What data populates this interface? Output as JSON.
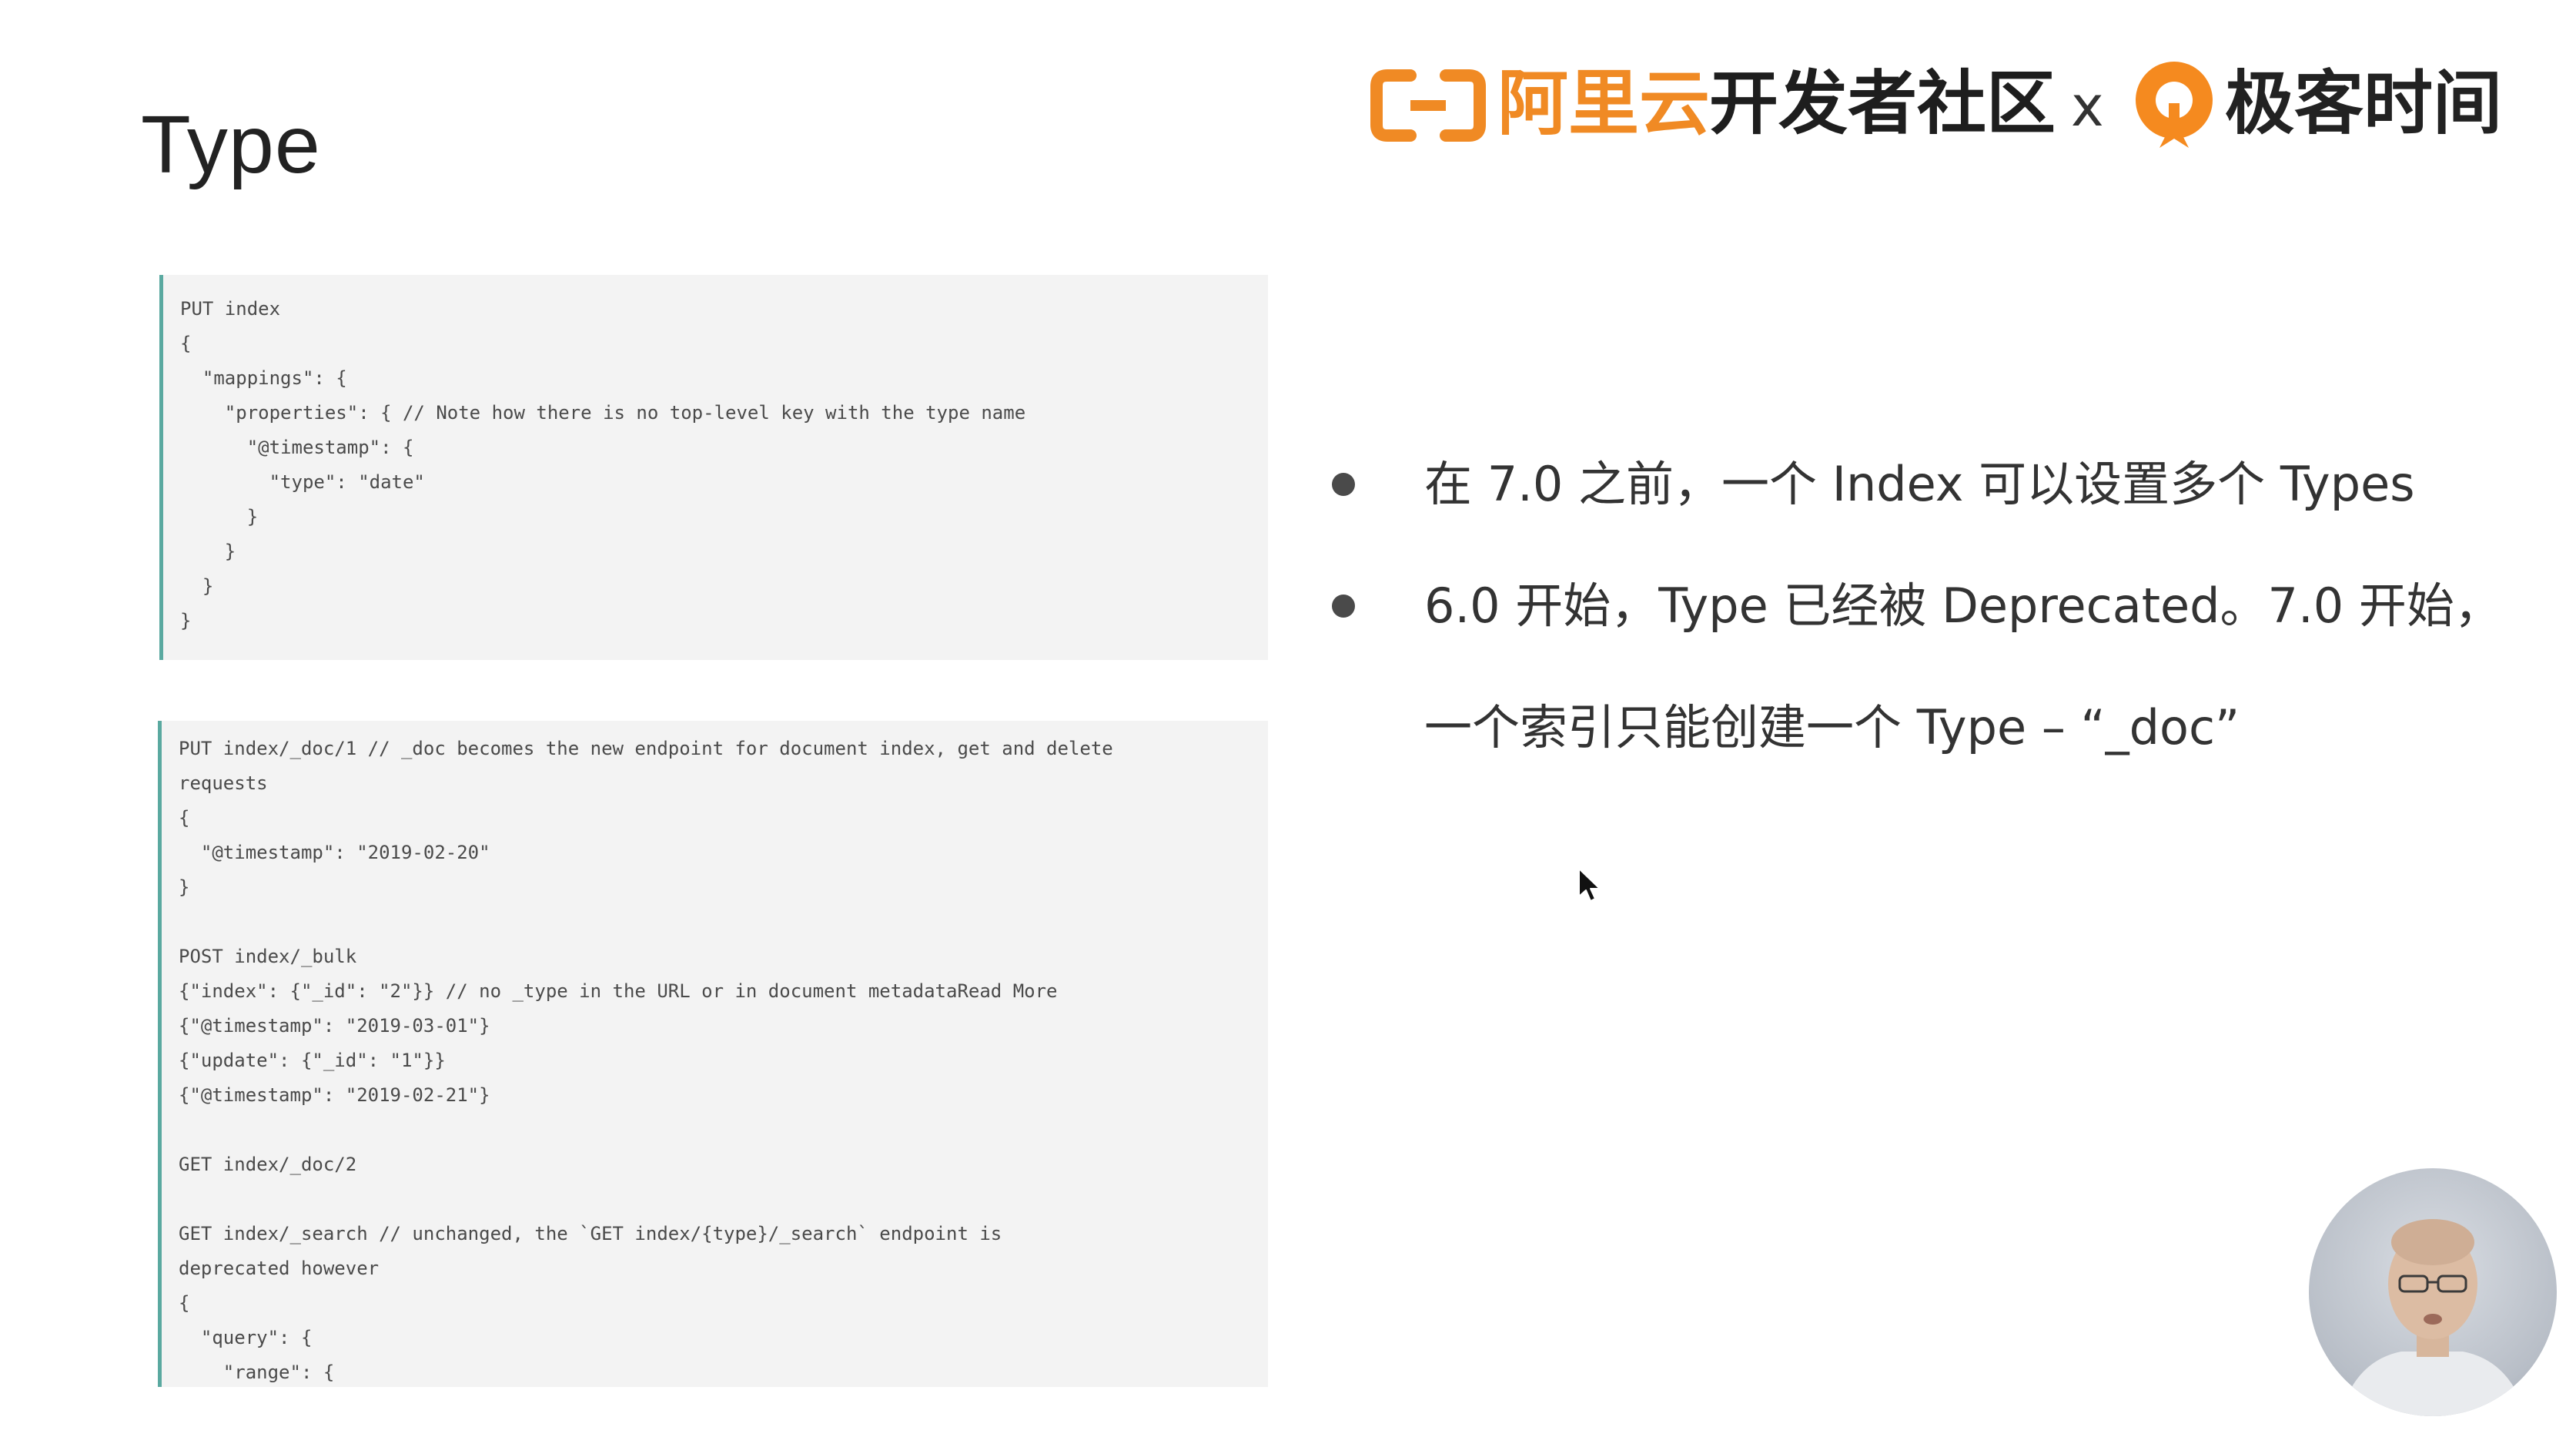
{
  "slide": {
    "title": "Type"
  },
  "brand": {
    "aliyun_logo_icon": "aliyun-bracket-icon",
    "aliyun_name": "阿里云",
    "community": "开发者社区",
    "separator": "x",
    "geek_logo_icon": "geektime-icon",
    "geek_name": "极客时间",
    "colors": {
      "aliyun_orange": "#f08a24",
      "geek_orange": "#f58a1f",
      "text_dark": "#1e1e1e"
    }
  },
  "code_top": {
    "lines": [
      "PUT index",
      "{",
      "  \"mappings\": {",
      "    \"properties\": { // Note how there is no top-level key with the type name",
      "      \"@timestamp\": {",
      "        \"type\": \"date\"",
      "      }",
      "    }",
      "  }",
      "}"
    ]
  },
  "code_bottom": {
    "lines": [
      "PUT index/_doc/1 // _doc becomes the new endpoint for document index, get and delete",
      "requests",
      "{",
      "  \"@timestamp\": \"2019-02-20\"",
      "}",
      "",
      "POST index/_bulk",
      "{\"index\": {\"_id\": \"2\"}} // no _type in the URL or in document metadataRead More",
      "{\"@timestamp\": \"2019-03-01\"}",
      "{\"update\": {\"_id\": \"1\"}}",
      "{\"@timestamp\": \"2019-02-21\"}",
      "",
      "GET index/_doc/2",
      "",
      "GET index/_search // unchanged, the `GET index/{type}/_search` endpoint is",
      "deprecated however",
      "{",
      "  \"query\": {",
      "    \"range\": {"
    ]
  },
  "bullets": [
    {
      "text": "在 7.0 之前，一个 Index 可以设置多个 Types"
    },
    {
      "text": "6.0 开始，Type 已经被 Deprecated。7.0 开始，",
      "continuation": "一个索引只能创建一个 Type – “_doc”"
    }
  ],
  "overlay": {
    "cursor_icon": "mouse-pointer-icon",
    "webcam": "presenter-webcam"
  },
  "colors": {
    "code_background": "#f3f3f3",
    "code_border": "#5aa9a0",
    "bullet": "#4a4a4a"
  }
}
